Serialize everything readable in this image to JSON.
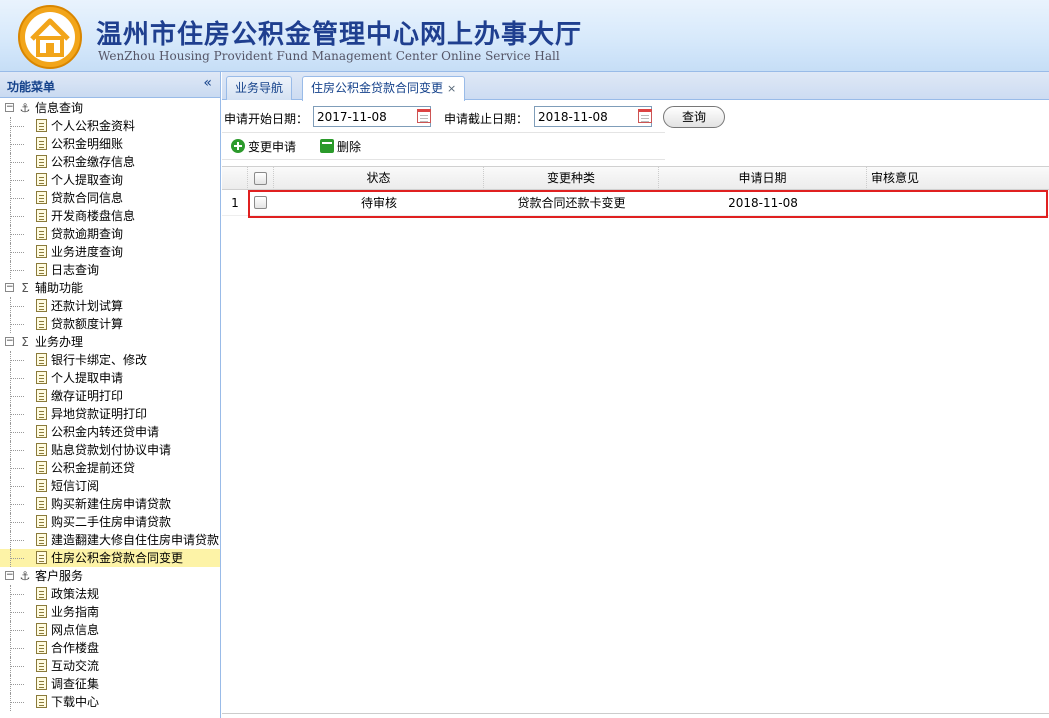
{
  "header": {
    "title": "温州市住房公积金管理中心网上办事大厅",
    "subtitle": "WenZhou Housing Provident Fund Management Center Online Service Hall"
  },
  "sidebar": {
    "title": "功能菜单",
    "collapse": "«",
    "groups": [
      {
        "label": "信息查询",
        "icon": "anchor-icon",
        "items": [
          "个人公积金资料",
          "公积金明细账",
          "公积金缴存信息",
          "个人提取查询",
          "贷款合同信息",
          "开发商楼盘信息",
          "贷款逾期查询",
          "业务进度查询",
          "日志查询"
        ]
      },
      {
        "label": "辅助功能",
        "icon": "sigma-icon",
        "items": [
          "还款计划试算",
          "贷款额度计算"
        ]
      },
      {
        "label": "业务办理",
        "icon": "sigma-icon",
        "items": [
          "银行卡绑定、修改",
          "个人提取申请",
          "缴存证明打印",
          "异地贷款证明打印",
          "公积金内转还贷申请",
          "贴息贷款划付协议申请",
          "公积金提前还贷",
          "短信订阅",
          "购买新建住房申请贷款",
          "购买二手住房申请贷款",
          "建造翻建大修自住住房申请贷款",
          "住房公积金贷款合同变更"
        ]
      },
      {
        "label": "客户服务",
        "icon": "anchor-icon",
        "items": [
          "政策法规",
          "业务指南",
          "网点信息",
          "合作楼盘",
          "互动交流",
          "调查征集",
          "下载中心"
        ]
      }
    ],
    "selected": "住房公积金贷款合同变更"
  },
  "tabs": [
    {
      "label": "业务导航"
    },
    {
      "label": "住房公积金贷款合同变更",
      "close": "×"
    }
  ],
  "search": {
    "start_label": "申请开始日期：",
    "start_value": "2017-11-08",
    "end_label": "申请截止日期：",
    "end_value": "2018-11-08",
    "button": "查询"
  },
  "actions": {
    "add": "变更申请",
    "delete": "删除"
  },
  "grid": {
    "columns": [
      "状态",
      "变更种类",
      "申请日期",
      "审核意见"
    ],
    "rows": [
      {
        "index": "1",
        "status": "待审核",
        "type": "贷款合同还款卡变更",
        "date": "2018-11-08",
        "opinion": ""
      }
    ]
  }
}
